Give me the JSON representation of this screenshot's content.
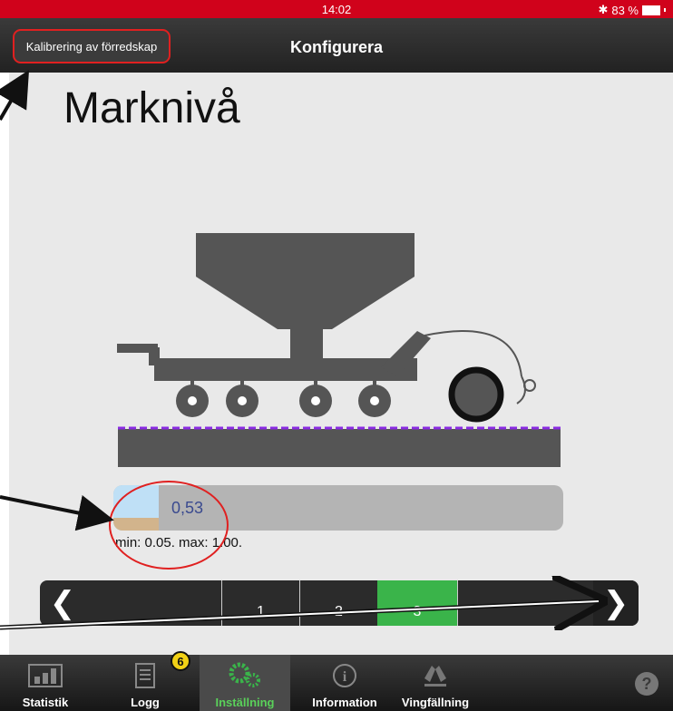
{
  "status": {
    "time": "14:02",
    "battery": "83 %",
    "bluetooth_icon": "bluetooth-icon"
  },
  "nav": {
    "back_label": "Kalibrering av förredskap",
    "title": "Konfigurera"
  },
  "page": {
    "title": "Marknivå"
  },
  "level": {
    "value": "0,53",
    "range_text": "min: 0.05. max: 1.00."
  },
  "pager": {
    "cells": [
      "1",
      "2",
      "3"
    ],
    "active_index": 2
  },
  "tabs": [
    {
      "label": "Statistik",
      "icon": "statistics-icon"
    },
    {
      "label": "Logg",
      "icon": "log-icon",
      "badge": "6"
    },
    {
      "label": "Inställning",
      "icon": "gears-icon",
      "active": true
    },
    {
      "label": "Information",
      "icon": "info-icon"
    },
    {
      "label": "Vingfällning",
      "icon": "wing-fold-icon"
    }
  ],
  "help_icon": "?",
  "colors": {
    "status_bar": "#d0021b",
    "accent_green": "#3ab44a",
    "highlight": "#e02020",
    "soil_line": "#8a2be2"
  }
}
